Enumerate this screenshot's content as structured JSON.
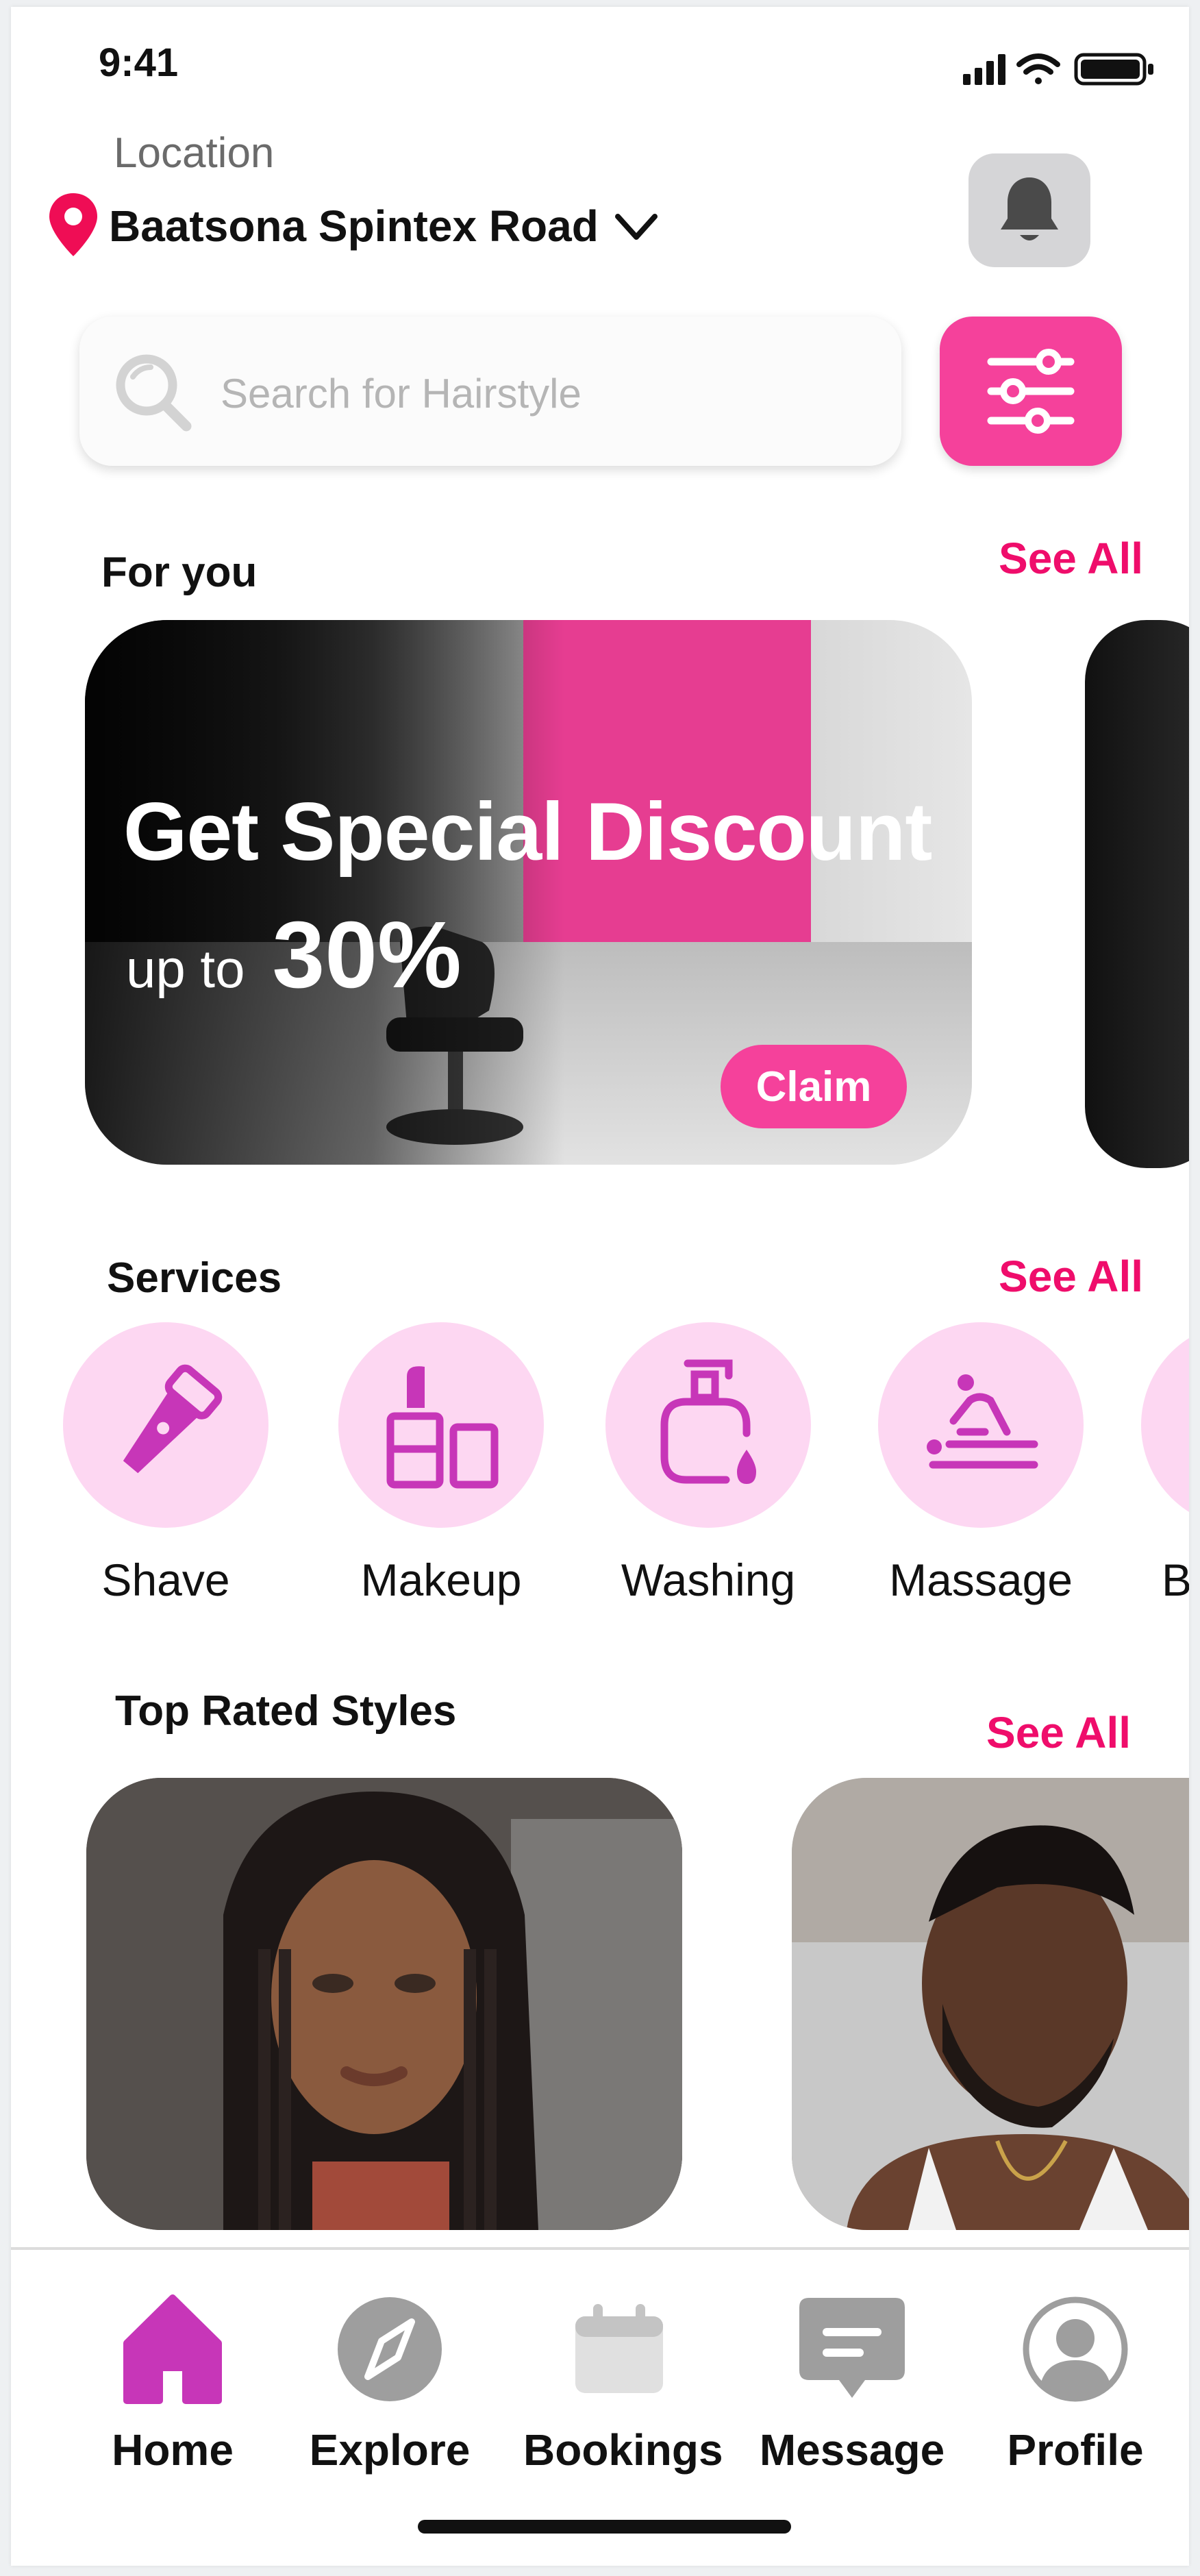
{
  "status": {
    "time": "9:41"
  },
  "location": {
    "label": "Location",
    "value": "Baatsona Spintex Road"
  },
  "search": {
    "placeholder": "Search for Hairstyle"
  },
  "for_you": {
    "title": "For you",
    "see_all": "See All"
  },
  "banner": {
    "title": "Get Special Discount",
    "sub_small": "up to",
    "sub_big": "30%",
    "claim": "Claim"
  },
  "services": {
    "title": "Services",
    "see_all": "See All",
    "items": [
      {
        "label": "Shave",
        "icon": "shaver-icon"
      },
      {
        "label": "Makeup",
        "icon": "lipstick-icon"
      },
      {
        "label": "Washing",
        "icon": "soap-bottle-icon"
      },
      {
        "label": "Massage",
        "icon": "massage-icon"
      },
      {
        "label": "Br",
        "icon": "brush-icon"
      }
    ]
  },
  "top_rated": {
    "title": "Top Rated Styles",
    "see_all": "See All"
  },
  "nav": {
    "items": [
      {
        "label": "Home",
        "icon": "home-icon",
        "active": true
      },
      {
        "label": "Explore",
        "icon": "compass-icon"
      },
      {
        "label": "Bookings",
        "icon": "calendar-icon"
      },
      {
        "label": "Message",
        "icon": "message-icon"
      },
      {
        "label": "Profile",
        "icon": "profile-icon"
      }
    ]
  },
  "colors": {
    "accent": "#f5419b",
    "link": "#ef0d6b",
    "service_bg": "#fdd7f2",
    "icon_purple": "#c736b8"
  }
}
